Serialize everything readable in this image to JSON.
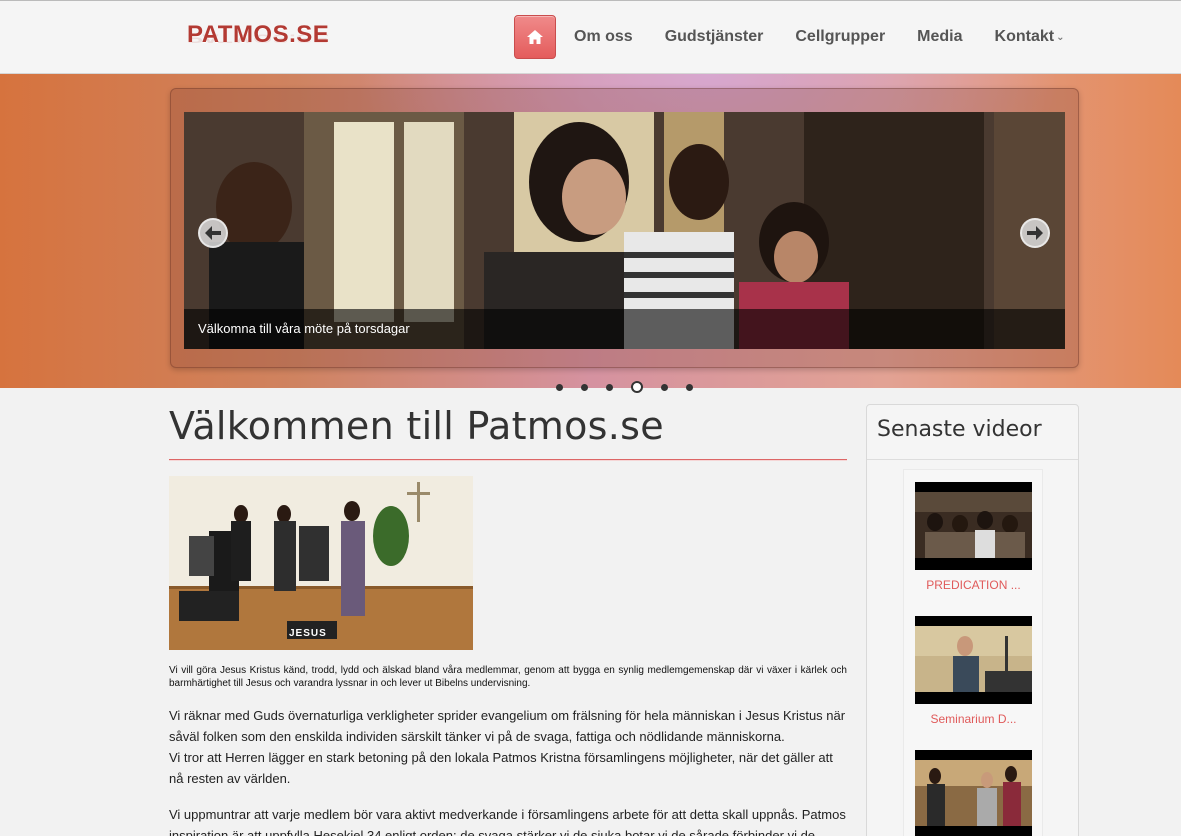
{
  "header": {
    "logo": "PATMOS.SE",
    "nav": [
      {
        "label": "Om oss"
      },
      {
        "label": "Gudstjänster"
      },
      {
        "label": "Cellgrupper"
      },
      {
        "label": "Media"
      },
      {
        "label": "Kontakt"
      }
    ]
  },
  "slider": {
    "caption": "Välkomna till våra möte på torsdagar",
    "dots": 6,
    "active_dot": 4
  },
  "main": {
    "title": "Välkommen till Patmos.se",
    "intro": "Vi vill göra Jesus Kristus känd, trodd, lydd och älskad bland våra medlemmar, genom att bygga en synlig medlemgemenskap där vi växer i kärlek och barmhärtighet till Jesus och varandra lyssnar in och lever ut Bibelns undervisning.",
    "para1_line1": " Vi räknar med Guds övernaturliga verkligheter sprider evangelium om frälsning för hela människan i Jesus Kristus när såväl folken som den enskilda individen särskilt tänker vi på de svaga, fattiga och nödlidande människorna.",
    "para1_line2": "Vi tror att Herren lägger en stark betoning på den lokala Patmos Kristna församlingens möjligheter, när det gäller att nå resten av världen.",
    "para2": "Vi uppmuntrar att varje medlem bör vara aktivt medverkande i församlingens arbete för att detta skall uppnås. Patmos inspiration är att uppfylla Hesekiel 34 enligt orden: de svaga stärker vi de sjuka botar vi de sårade förbinder vi de",
    "photo_sign": "JESUS"
  },
  "sidebar": {
    "title": "Senaste videor",
    "videos": [
      {
        "label": "PREDICATION ..."
      },
      {
        "label": "Seminarium D..."
      },
      {
        "label": ""
      }
    ]
  },
  "colors": {
    "accent": "#e45c5c",
    "logo": "#b33a33",
    "link": "#e05a5a"
  }
}
